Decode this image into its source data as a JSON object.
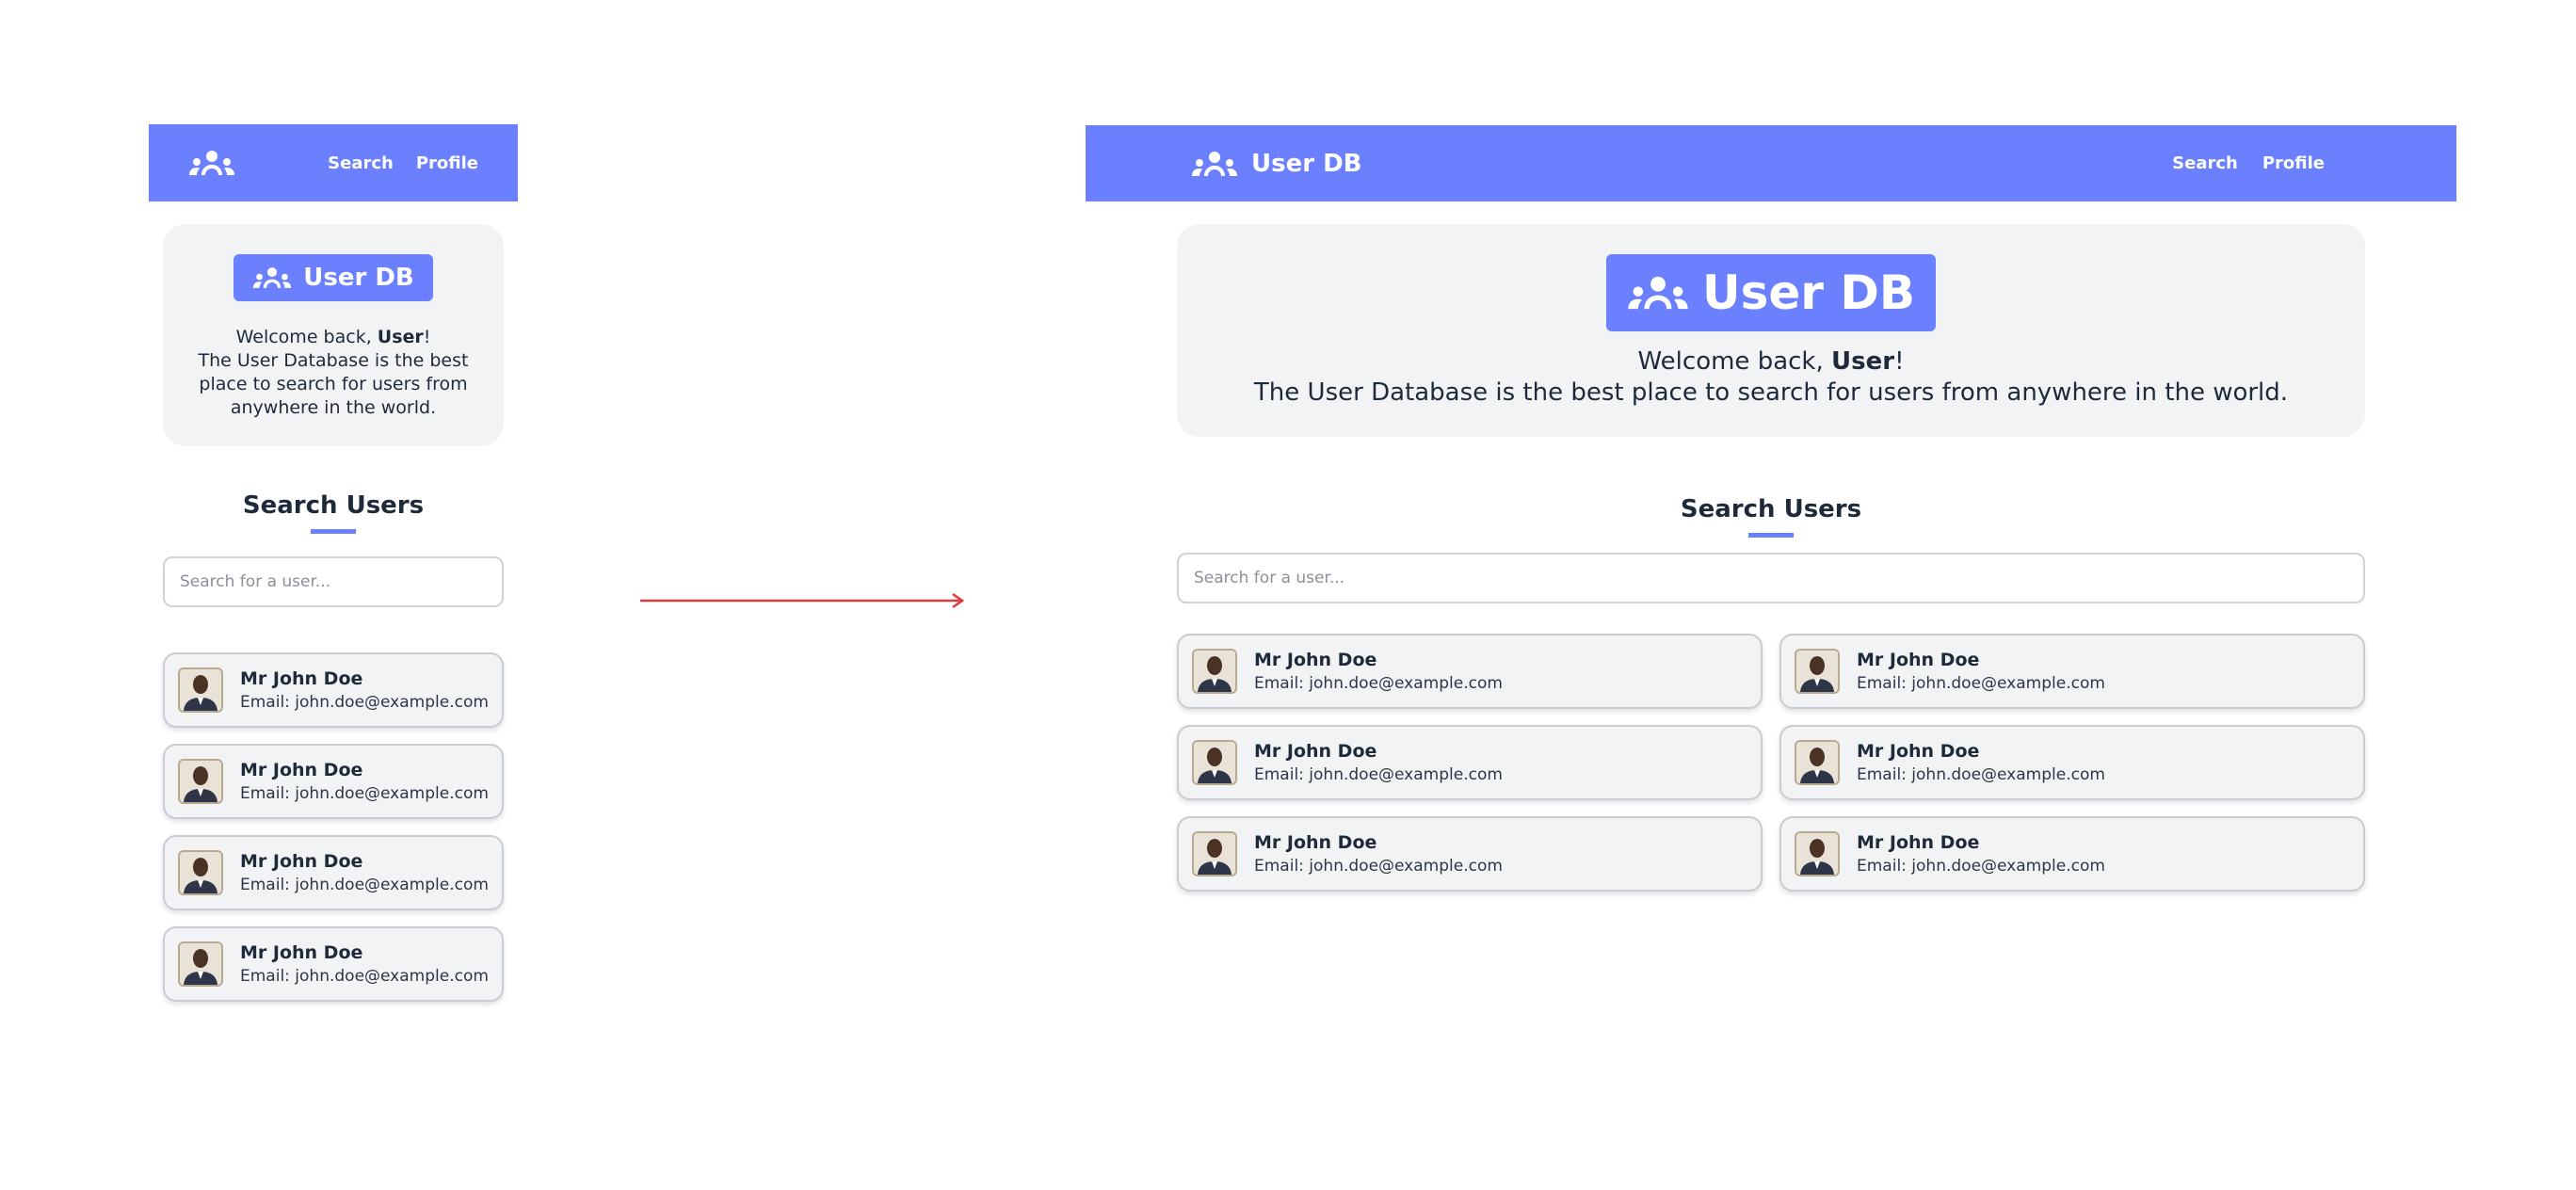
{
  "nav": {
    "brand": "User DB",
    "links": [
      "Search",
      "Profile"
    ]
  },
  "hero": {
    "badge": "User DB",
    "welcome_prefix": "Welcome back, ",
    "welcome_user": "User",
    "welcome_suffix": "!",
    "description": "The User Database is the best place to search for users from anywhere in the world."
  },
  "search": {
    "title": "Search Users",
    "placeholder": "Search for a user..."
  },
  "users": [
    {
      "name": "Mr John Doe",
      "email": "Email: john.doe@example.com"
    },
    {
      "name": "Mr John Doe",
      "email": "Email: john.doe@example.com"
    },
    {
      "name": "Mr John Doe",
      "email": "Email: john.doe@example.com"
    },
    {
      "name": "Mr John Doe",
      "email": "Email: john.doe@example.com"
    },
    {
      "name": "Mr John Doe",
      "email": "Email: john.doe@example.com"
    },
    {
      "name": "Mr John Doe",
      "email": "Email: john.doe@example.com"
    }
  ],
  "colors": {
    "accent": "#6a80ff",
    "panel": "#f2f3f5",
    "arrow": "#e03b3b"
  },
  "icons": {
    "brand": "users-group-icon",
    "avatar": "user-photo-avatar"
  }
}
